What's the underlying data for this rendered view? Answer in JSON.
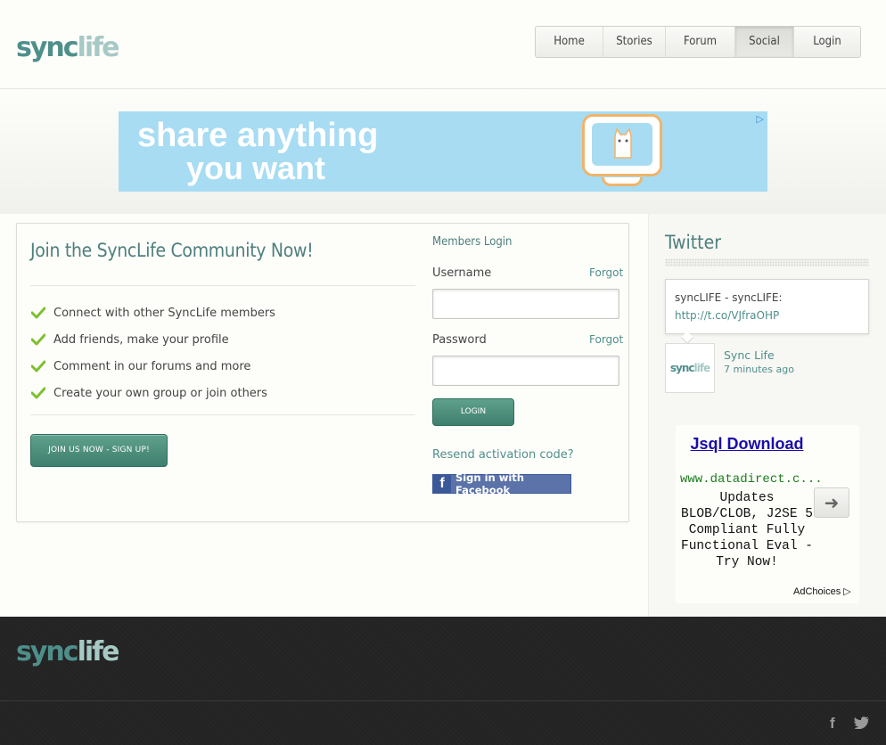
{
  "brand": {
    "logo_part1": "sync",
    "logo_part2": "life",
    "avatar_part1": "sync",
    "avatar_part2": "life"
  },
  "nav": {
    "items": [
      "Home",
      "Stories",
      "Forum",
      "Social",
      "Login"
    ],
    "active": "Social"
  },
  "banner_ad": {
    "line1": "share anything",
    "line2": "you want",
    "colors": {
      "bg": "#a7dcf3",
      "accent": "#f0b46b"
    }
  },
  "join": {
    "title": "Join the SyncLife Community Now!",
    "features": [
      "Connect with other SyncLife members",
      "Add friends, make your profile",
      "Comment in our forums and more",
      "Create your own group or join others"
    ],
    "signup_button": "JOIN US NOW - SIGN UP!"
  },
  "login": {
    "heading": "Members Login",
    "username_label": "Username",
    "password_label": "Password",
    "forgot_label": "Forgot",
    "username_value": "",
    "password_value": "",
    "login_button": "LOGIN",
    "resend_link": "Resend activation code?",
    "facebook_button": "Sign in with Facebook"
  },
  "twitter": {
    "title": "Twitter",
    "tweet_text": "syncLIFE - syncLIFE: ",
    "tweet_link": "http://t.co/VJfraOHP",
    "user_name": "Sync Life",
    "time": "7 minutes ago"
  },
  "sidebar_ad": {
    "title": "Jsql Download",
    "url": "www.datadirect.c...",
    "description": "Updates BLOB/CLOB, J2SE 5 Compliant Fully Functional Eval - Try Now!",
    "adchoices": "AdChoices"
  },
  "footer": {
    "logo_part1": "sync",
    "logo_part2": "life",
    "icons": [
      "facebook-icon",
      "twitter-icon"
    ]
  },
  "colors": {
    "brand_teal": "#4f8f8b",
    "brand_light": "#a7c9c6",
    "button_green": "#4f8f7d",
    "footer_bg": "#232323"
  }
}
